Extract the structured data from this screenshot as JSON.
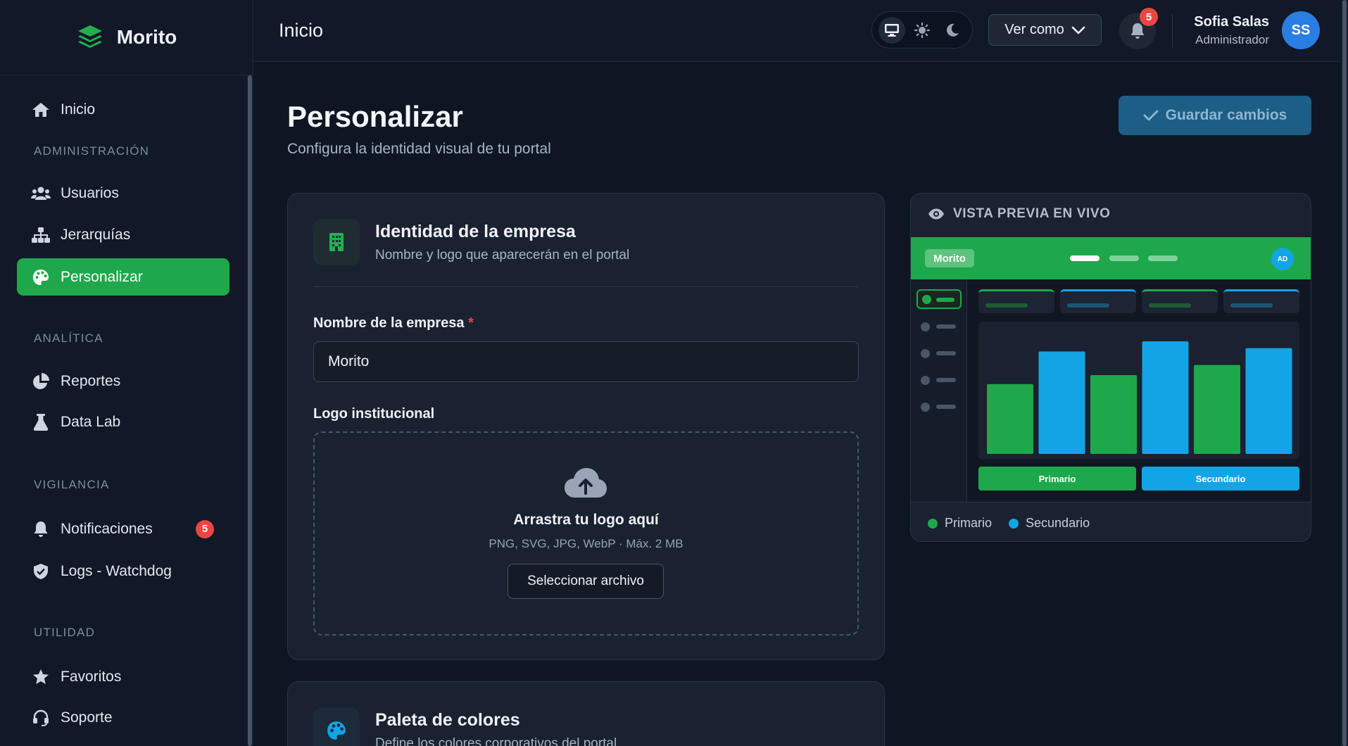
{
  "app": {
    "name": "Morito"
  },
  "sidebar": {
    "home": "Inicio",
    "sections": {
      "admin": "ADMINISTRACIÓN",
      "analytics": "ANALÍTICA",
      "monitoring": "VIGILANCIA",
      "utility": "UTILIDAD"
    },
    "items": {
      "users": "Usuarios",
      "hierarchies": "Jerarquías",
      "customize": "Personalizar",
      "reports": "Reportes",
      "datalab": "Data Lab",
      "notifications": "Notificaciones",
      "notifications_count": "5",
      "logs": "Logs - Watchdog",
      "favorites": "Favoritos",
      "support": "Soporte"
    }
  },
  "topbar": {
    "title": "Inicio",
    "view_as": "Ver como",
    "notif_count": "5",
    "user": {
      "name": "Sofia Salas",
      "role": "Administrador",
      "initials": "SS"
    }
  },
  "page": {
    "title": "Personalizar",
    "subtitle": "Configura la identidad visual de tu portal",
    "save_label": "Guardar cambios"
  },
  "identity_card": {
    "title": "Identidad de la empresa",
    "subtitle": "Nombre y logo que aparecerán en el portal",
    "name_label": "Nombre de la empresa",
    "required_mark": "*",
    "name_value": "Morito",
    "logo_label": "Logo institucional",
    "drop_title": "Arrastra tu logo aquí",
    "drop_formats": "PNG, SVG, JPG, WebP · Máx. 2 MB",
    "select_button": "Seleccionar archivo"
  },
  "palette_card": {
    "title": "Paleta de colores",
    "subtitle": "Define los colores corporativos del portal"
  },
  "preview": {
    "heading": "VISTA PREVIA EN VIVO",
    "brand": "Morito",
    "avatar": "AD",
    "primary_button": "Primario",
    "secondary_button": "Secundario",
    "legend_primary": "Primario",
    "legend_secondary": "Secundario",
    "bar_levels": [
      0.62,
      0.91,
      0.7,
      1.0,
      0.79,
      0.94
    ]
  },
  "colors": {
    "primary": "#1ea84b",
    "secondary": "#13a4e6",
    "background": "#0f1623",
    "danger": "#ef4444"
  }
}
